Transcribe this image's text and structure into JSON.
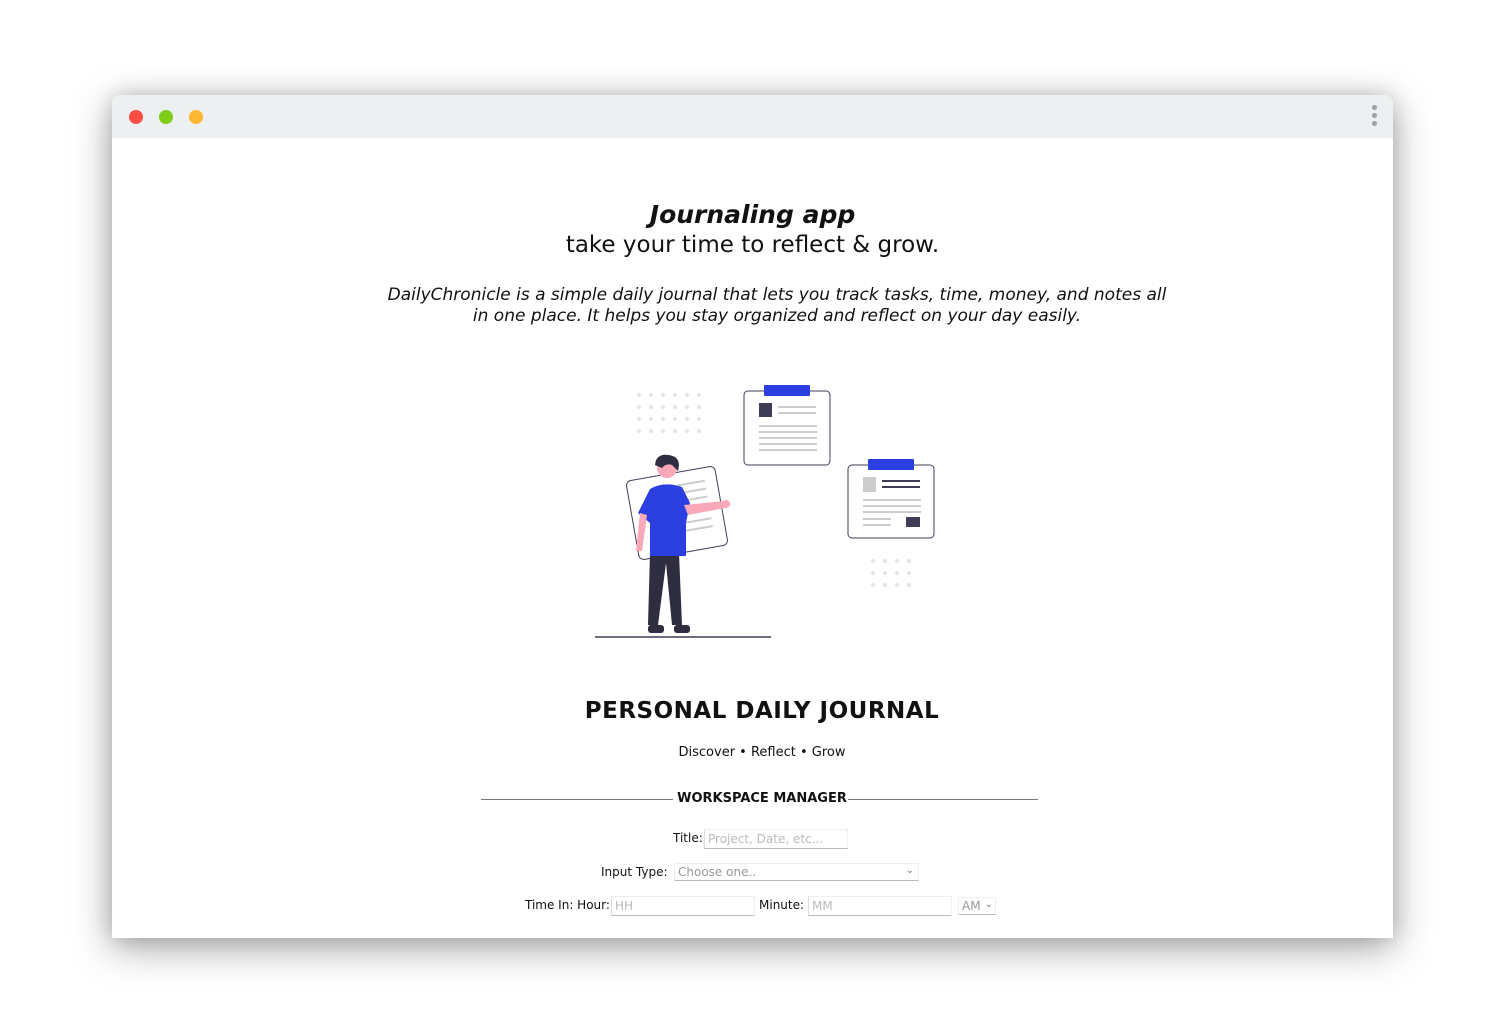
{
  "window": {
    "controls": [
      "close",
      "minimize",
      "maximize"
    ],
    "menu_icon": "kebab-menu-icon"
  },
  "hero": {
    "title": "Journaling app",
    "subtitle": "take your time to reflect & grow.",
    "description": "DailyChronicle is a simple daily journal that lets you track tasks, time, money, and notes all in one place. It helps you stay organized and reflect on your day easily."
  },
  "illustration": {
    "icon": "person-with-journal-illustration",
    "accent_color": "#2b3ee0"
  },
  "journal": {
    "title": "PERSONAL DAILY JOURNAL",
    "tagline": "Discover • Reflect • Grow",
    "section_legend": "WORKSPACE MANAGER"
  },
  "form": {
    "title_label": "Title:",
    "title_placeholder": "Project, Date, etc...",
    "input_type_label": "Input Type:",
    "input_type_value": "Choose one..",
    "time_in_label": "Time In: Hour:",
    "hour_placeholder": "HH",
    "minute_label": "Minute:",
    "minute_placeholder": "MM",
    "ampm_value": "AM"
  }
}
